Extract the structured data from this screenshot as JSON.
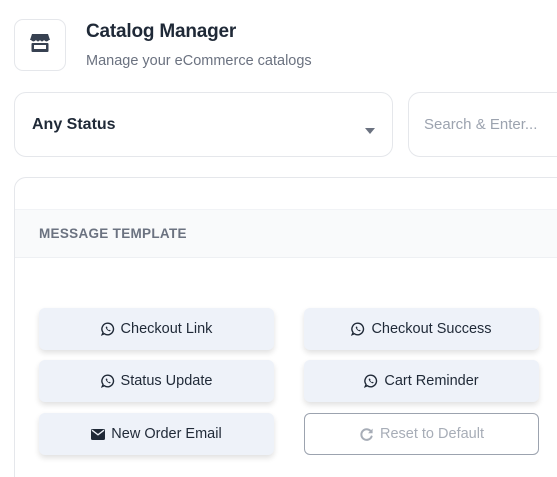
{
  "header": {
    "title": "Catalog Manager",
    "subtitle": "Manage your eCommerce catalogs",
    "logo_icon": "store-icon"
  },
  "filters": {
    "status_selected": "Any Status",
    "search_placeholder": "Search & Enter...",
    "search_value": ""
  },
  "template_section": {
    "heading": "MESSAGE TEMPLATE",
    "buttons": [
      {
        "label": "Checkout Link",
        "icon": "whatsapp-icon"
      },
      {
        "label": "Checkout Success",
        "icon": "whatsapp-icon"
      },
      {
        "label": "Status Update",
        "icon": "whatsapp-icon"
      },
      {
        "label": "Cart Reminder",
        "icon": "whatsapp-icon"
      },
      {
        "label": "New Order Email",
        "icon": "envelope-icon"
      }
    ],
    "reset_label": "Reset to Default",
    "reset_icon": "refresh-icon"
  },
  "colors": {
    "text_primary": "#1f2937",
    "text_muted": "#6b7280",
    "button_bg": "#eef2f9",
    "border": "#e5e7eb",
    "disabled_text": "#a7adb7"
  }
}
